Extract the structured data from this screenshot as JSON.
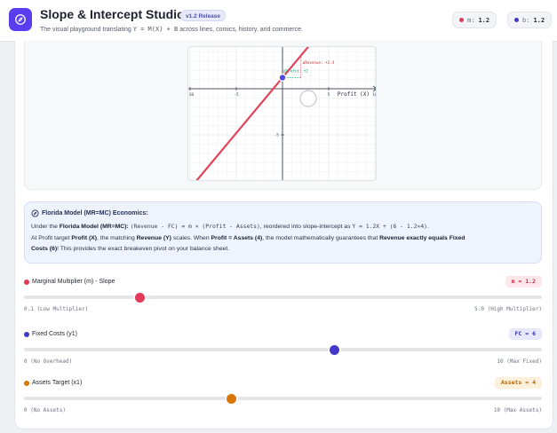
{
  "header": {
    "title": "Slope & Intercept Studio",
    "version": "v1.2 Release",
    "subtitle_pre": "The visual playground translating",
    "subtitle_formula": "Y = M(X) + B",
    "subtitle_post": "across lines, comics, history, and commerce.",
    "m_key": "m:",
    "m_value": "1.2",
    "b_key": "b:",
    "b_value": "1.2"
  },
  "colors": {
    "accent": "#5b3df0",
    "slope": "#e23a5b",
    "intercept": "#4338ca",
    "target": "#d97706",
    "line": "#e04458",
    "point": "#4f46e5"
  },
  "chart": {
    "revenue_label": "ΔRevenue: +2.4",
    "profit_label": "ΔProfit: +2",
    "x_axis_label": "Profit (X)",
    "x_ticks": [
      "-10",
      "-5",
      "5",
      "10"
    ],
    "y_ticks": [
      "-5"
    ]
  },
  "chart_data": {
    "type": "line",
    "xlim": [
      -10,
      10
    ],
    "ylim": [
      -10,
      5
    ],
    "grid": true,
    "series": [
      {
        "slope": 1.2,
        "intercept": 1.2,
        "x": [
          -10,
          10
        ],
        "y": [
          -10.8,
          13.2
        ]
      }
    ],
    "highlight_point": {
      "x": 0,
      "y": 1.2
    },
    "delta_run": 2,
    "delta_rise": 2.4
  },
  "info": {
    "title": "Florida Model (MR=MC) Economics:",
    "l1_pre": "Under the",
    "l1_bold": "Florida Model (MR=MC)",
    "l1_colon": ":",
    "l1_formula1": "(Revenue - FC) = m × (Profit - Assets)",
    "l1_mid": ", reordered into slope-intercept as",
    "l1_formula2": "Y = 1.2X + (6 - 1.2×4)",
    "l1_end": ".",
    "l2_a": "At Profit target",
    "l2_b": "Profit (X)",
    "l2_c": ", the matching",
    "l2_d": "Revenue (Y)",
    "l2_e": "scales. When",
    "l2_f": "Profit = Assets (4)",
    "l2_g": ", the model mathematically guarantees that",
    "l2_h": "Revenue exactly equals Fixed",
    "l3_a": "Costs (6)",
    "l3_b": "! This provides the exact breakeven pivot on your balance sheet."
  },
  "sliders": [
    {
      "label": "Marginal Multiplier (m) - Slope",
      "badge": "m = 1.2",
      "min_label": "0.1 (Low Multiplier)",
      "max_label": "5.0 (High Multiplier)",
      "min": 0.1,
      "max": 5.0,
      "value": 1.2,
      "color": "#e23a5b",
      "badge_bg": "#fde7ea",
      "badge_fg": "#c72848"
    },
    {
      "label": "Fixed Costs (y1)",
      "badge": "FC = 6",
      "min_label": "0 (No Overhead)",
      "max_label": "10 (Max Fixed)",
      "min": 0,
      "max": 10,
      "value": 6,
      "color": "#4338ca",
      "badge_bg": "#e6e8fb",
      "badge_fg": "#3a33b4"
    },
    {
      "label": "Assets Target (x1)",
      "badge": "Assets = 4",
      "min_label": "0 (No Assets)",
      "max_label": "10 (Max Assets)",
      "min": 0,
      "max": 10,
      "value": 4,
      "color": "#d97706",
      "badge_bg": "#fdf1dc",
      "badge_fg": "#b26205"
    }
  ]
}
